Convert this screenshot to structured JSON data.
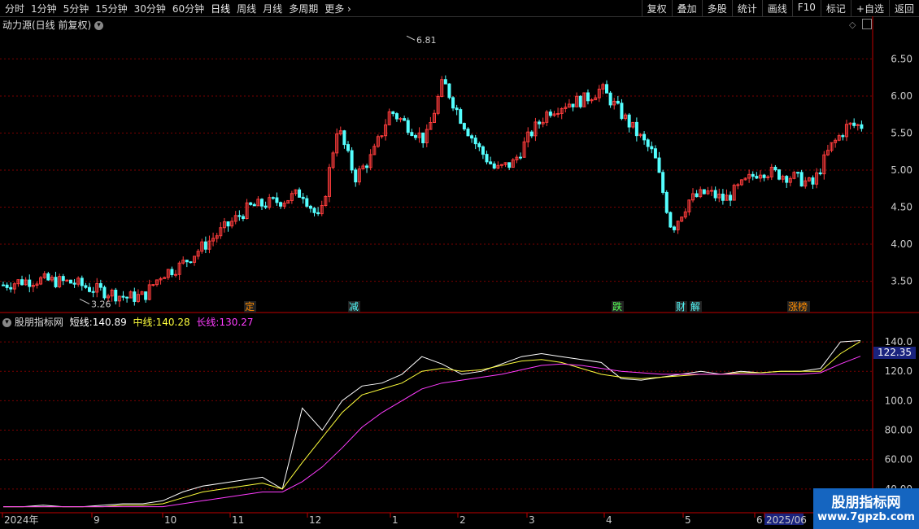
{
  "toolbar": {
    "periods": [
      "分时",
      "1分钟",
      "5分钟",
      "15分钟",
      "30分钟",
      "60分钟",
      "日线",
      "周线",
      "月线",
      "多周期",
      "更多"
    ],
    "active_period": "日线",
    "actions": [
      "复权",
      "叠加",
      "多股",
      "统计",
      "画线",
      "F10",
      "标记",
      "+自选",
      "返回"
    ]
  },
  "main_panel": {
    "title": "动力源(日线 前复权)",
    "high_label": "6.81",
    "low_label": "3.26",
    "event_tags": [
      "定",
      "减",
      "跌",
      "财",
      "解",
      "涨榜"
    ]
  },
  "indicator_panel": {
    "name": "股朋指标网",
    "short_label": "短线:",
    "short_value": "140.89",
    "mid_label": "中线:",
    "mid_value": "140.28",
    "long_label": "长线:",
    "long_value": "130.27",
    "cursor_value": "122.35"
  },
  "x_axis": {
    "labels": [
      "2024年",
      "9",
      "10",
      "11",
      "12",
      "1",
      "2",
      "3",
      "4",
      "5",
      "6",
      "2025/06"
    ]
  },
  "watermark": {
    "line1": "股朋指标网",
    "line2": "www.7gpzb.com"
  },
  "colors": {
    "up": "#ff3c3c",
    "down": "#54ffff",
    "short": "#ffffff",
    "mid": "#ffff3c",
    "long": "#ff3cff",
    "axis": "#c00000",
    "grid": "#7a0000"
  },
  "chart_data": [
    {
      "type": "candlestick",
      "title": "动力源(日线 前复权)",
      "y_ticks": [
        3.5,
        4.0,
        4.5,
        5.0,
        5.5,
        6.0,
        6.5
      ],
      "ylim": [
        3.1,
        6.9
      ],
      "close_path_x": [
        0,
        5,
        10,
        15,
        20,
        25,
        30,
        35,
        40,
        45,
        50,
        55,
        60,
        65,
        70,
        75,
        80,
        85,
        90,
        95,
        100,
        105,
        110,
        115,
        120,
        125,
        130,
        135,
        140,
        145,
        150,
        155,
        160,
        165,
        170,
        175,
        180,
        185,
        190,
        195,
        200,
        205,
        210,
        215,
        220,
        225,
        230,
        235,
        240,
        245
      ],
      "close_path_y": [
        3.45,
        3.5,
        3.52,
        3.5,
        3.48,
        3.4,
        3.35,
        3.28,
        3.3,
        3.6,
        3.7,
        3.9,
        4.1,
        4.3,
        4.5,
        4.55,
        4.6,
        4.7,
        4.3,
        5.6,
        4.9,
        5.2,
        5.8,
        5.6,
        5.4,
        6.2,
        5.7,
        5.3,
        5.0,
        5.1,
        5.5,
        5.8,
        5.9,
        5.95,
        6.1,
        5.8,
        5.5,
        5.2,
        4.2,
        4.6,
        4.7,
        4.6,
        4.8,
        5.0,
        4.95,
        4.9,
        4.8,
        5.3,
        5.6,
        5.6
      ],
      "high": 6.81,
      "low": 3.26
    },
    {
      "type": "line",
      "y_ticks": [
        40.0,
        60.0,
        80.0,
        100.0,
        120.0,
        140.0
      ],
      "ylim": [
        25,
        150
      ],
      "series": [
        {
          "name": "短线",
          "values": [
            28,
            28,
            29,
            28,
            28,
            29,
            30,
            30,
            32,
            38,
            42,
            44,
            46,
            48,
            40,
            95,
            80,
            100,
            110,
            112,
            118,
            130,
            125,
            118,
            120,
            125,
            130,
            132,
            130,
            128,
            126,
            115,
            114,
            116,
            118,
            120,
            118,
            120,
            119,
            120,
            120,
            122,
            140,
            140.89
          ]
        },
        {
          "name": "中线",
          "values": [
            28,
            28,
            28,
            28,
            28,
            28,
            29,
            29,
            30,
            34,
            38,
            40,
            42,
            44,
            40,
            58,
            75,
            92,
            104,
            108,
            112,
            120,
            122,
            120,
            121,
            124,
            127,
            128,
            126,
            122,
            118,
            116,
            115,
            116,
            117,
            118,
            118,
            119,
            119,
            120,
            120,
            120,
            132,
            140.28
          ]
        },
        {
          "name": "长线",
          "values": [
            28,
            28,
            28,
            28,
            28,
            28,
            28,
            28,
            28,
            30,
            32,
            34,
            36,
            38,
            38,
            45,
            55,
            68,
            82,
            92,
            100,
            108,
            112,
            114,
            116,
            118,
            121,
            124,
            125,
            124,
            122,
            120,
            119,
            118,
            118,
            118,
            118,
            118,
            118,
            118,
            118,
            119,
            125,
            130.27
          ]
        }
      ]
    }
  ]
}
